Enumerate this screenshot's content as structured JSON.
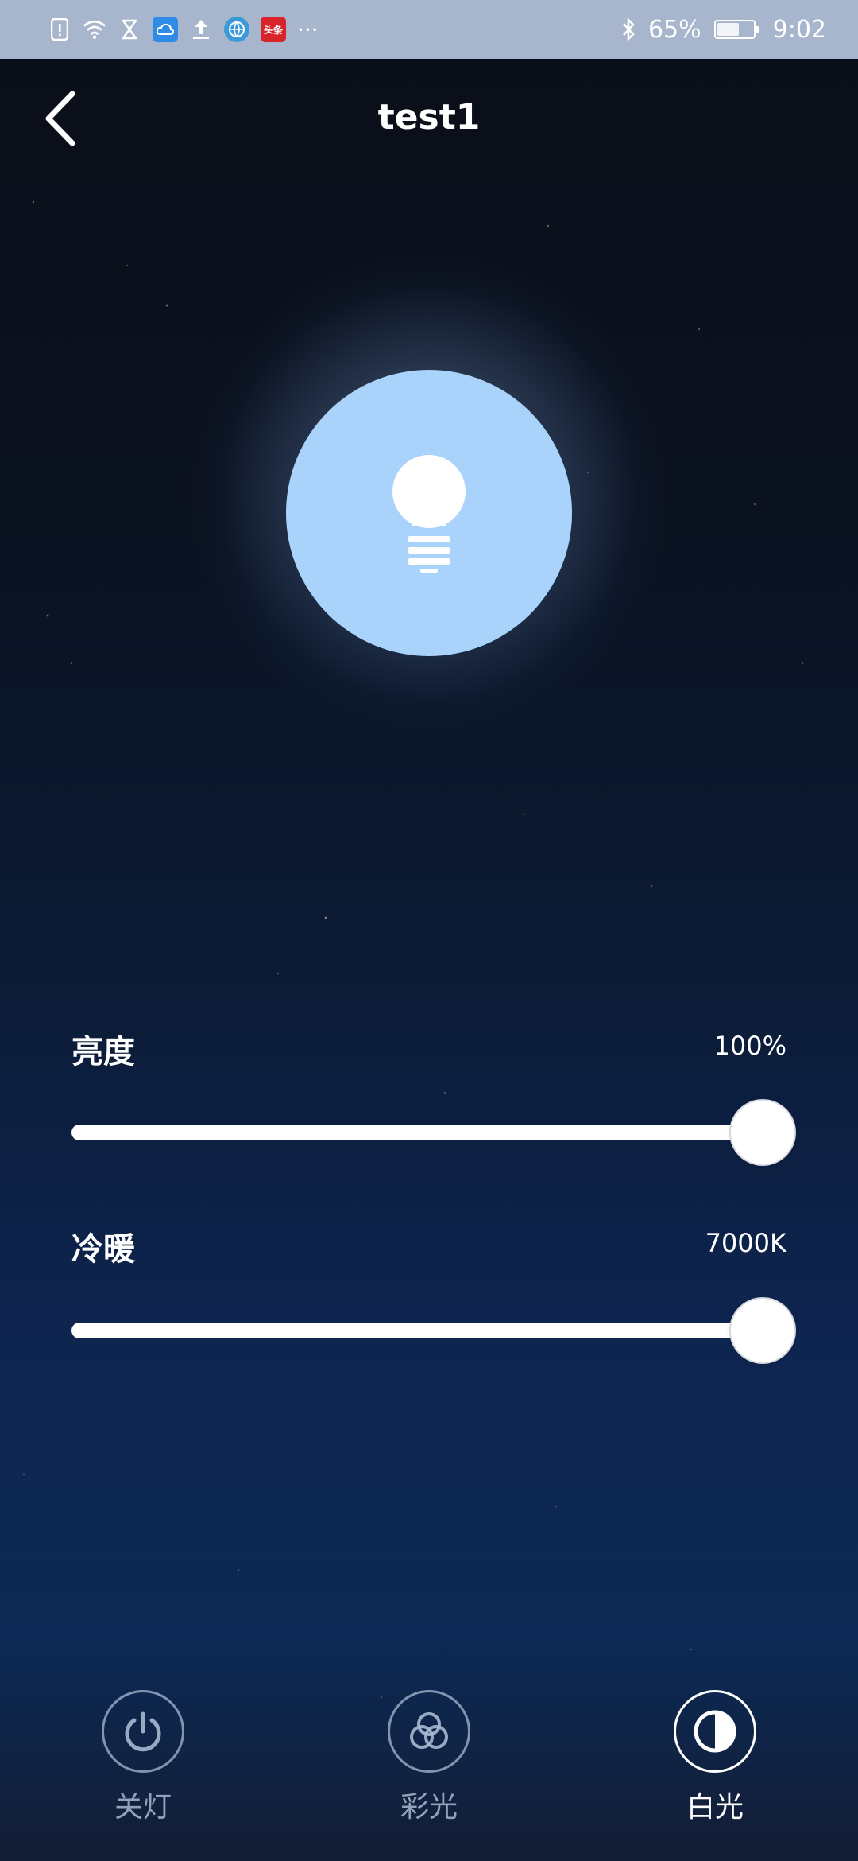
{
  "status_bar": {
    "apps": [
      "alert-icon",
      "wifi-icon",
      "hourglass-icon",
      "cloud-app-icon",
      "upload-icon",
      "globe-app-icon",
      "toutiao-app-icon"
    ],
    "toutiao_text": "头条",
    "more": "···",
    "battery": "65%",
    "battery_level": 0.65,
    "time": "9:02",
    "bg_color": "#a7b6cc"
  },
  "header": {
    "title": "test1"
  },
  "bulb": {
    "color": "#aad3fb",
    "icon": "lightbulb-icon"
  },
  "brightness": {
    "label": "亮度",
    "value_text": "100%",
    "value": 100,
    "min": 0,
    "max": 100
  },
  "color_temp": {
    "label": "冷暖",
    "value_text": "7000K",
    "value": 7000,
    "min": 2700,
    "max": 7000
  },
  "modes": [
    {
      "label": "关灯",
      "icon": "power-icon",
      "active": false
    },
    {
      "label": "彩光",
      "icon": "color-circles-icon",
      "active": false
    },
    {
      "label": "白光",
      "icon": "half-circle-icon",
      "active": true
    }
  ]
}
